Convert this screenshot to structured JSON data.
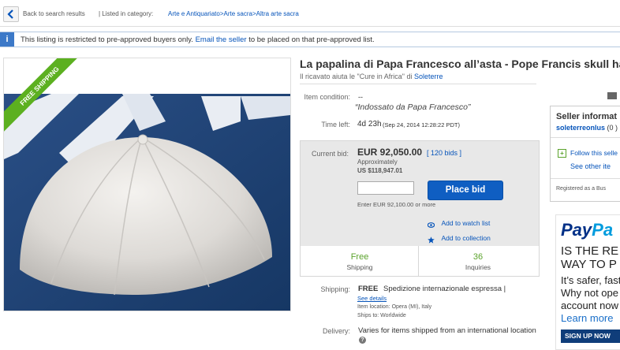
{
  "nav": {
    "back_label": "Back to search results",
    "category_prefix": "| Listed in category:",
    "breadcrumb": "Arte e Antiquariato>Arte sacra>Altra arte sacra"
  },
  "notice": {
    "icon": "i",
    "text_before": "This listing is restricted to pre-approved buyers only.",
    "link": "Email the seller",
    "text_after": "to be placed on that pre-approved list."
  },
  "image": {
    "ribbon": "FREE SHIPPING"
  },
  "item": {
    "title": "La papalina di Papa Francesco all’asta - Pope Francis skull hat",
    "subtitle_before": "Il ricavato aiuta le \"Cure in Africa\" di",
    "subtitle_link": "Soleterre",
    "condition_label": "Item condition:",
    "condition_value": "--",
    "condition_quote": "“Indossato da Papa Francesco”",
    "time_label": "Time left:",
    "time_value": "4d 23h",
    "time_detail": "(Sep 24, 2014   12:28:22 PDT)"
  },
  "bid": {
    "label": "Current bid:",
    "price": "EUR 92,050.00",
    "bids": "[ 120 bids ]",
    "approx": "Approximately",
    "usd": "US $118,947.01",
    "input_value": "",
    "button": "Place bid",
    "enter": "Enter EUR 92,100.00 or more",
    "watch": "Add to watch list",
    "collection": "Add to collection"
  },
  "stats": {
    "shipping_big": "Free",
    "shipping_small": "Shipping",
    "inquiries_big": "36",
    "inquiries_small": "Inquiries"
  },
  "shipping": {
    "label": "Shipping:",
    "free": "FREE",
    "method": "Spedizione internazionale espressa |",
    "see_details": "See details",
    "location": "Item location:  Opera (MI), Italy",
    "ships_to": "Ships to:  Worldwide",
    "delivery_label": "Delivery:",
    "delivery_value": "Varies for items shipped from an international location",
    "help": "?"
  },
  "seller": {
    "heading": "Seller informat",
    "name": "soleterreonlus",
    "feedback": "(0 )",
    "follow": "Follow this selle",
    "see_other": "See other ite",
    "registered": "Registered as a Bus"
  },
  "ad": {
    "logo_pay": "Pay",
    "logo_pal": "Pa",
    "line1": "IS THE RE",
    "line2": "WAY TO P",
    "line3": "It’s safer, fast",
    "line4": "Why not ope",
    "line5": "account now",
    "learn": "Learn more",
    "signup": "SIGN UP NOW",
    "colors": {
      "pay": "#003087",
      "pal": "#009cde"
    }
  }
}
